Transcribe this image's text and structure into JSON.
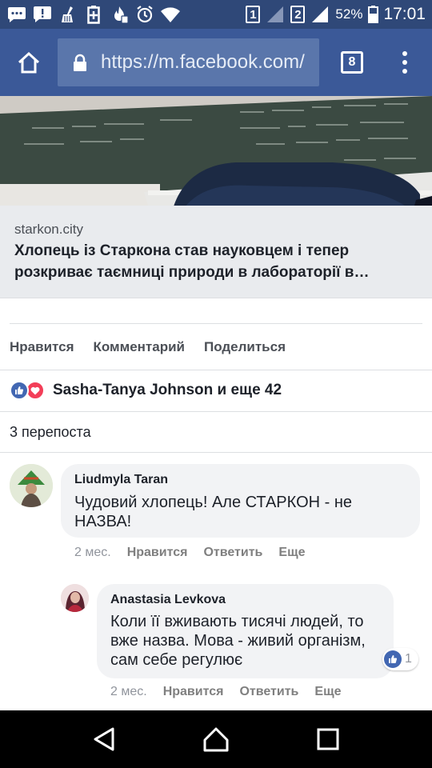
{
  "status_bar": {
    "time": "17:01",
    "battery_percent": "52%",
    "sim1": "1",
    "sim2": "2",
    "icons": [
      "chat-icon",
      "alert-icon",
      "broom-icon",
      "battery-saver-icon",
      "fire-icon",
      "alarm-icon",
      "wifi-icon",
      "signal-icon",
      "battery-icon"
    ]
  },
  "browser": {
    "url": "https://m.facebook.com/",
    "tab_count": "8",
    "icons": [
      "home-icon",
      "lock-icon",
      "more-vert-icon"
    ]
  },
  "link_preview": {
    "domain": "starkon.city",
    "title": "Хлопець із Старкона став науковцем і тепер розкриває таємниці природи в лабораторії в…"
  },
  "actions": {
    "like": "Нравится",
    "comment": "Комментарий",
    "share": "Поделиться"
  },
  "reactions": {
    "summary": "Sasha-Tanya Johnson и еще 42",
    "types": [
      "like-reaction-icon",
      "love-reaction-icon"
    ]
  },
  "shares_count": "3 перепоста",
  "comments": [
    {
      "author": "Liudmyla Taran",
      "text": "Чудовий хлопець! Але СТАРКОН - не НАЗВА!",
      "time": "2 мес.",
      "like": "Нравится",
      "reply": "Ответить",
      "more": "Еще"
    },
    {
      "author": "Anastasia Levkova",
      "text": "Коли її вживають тисячі людей, то вже назва. Мова - живий організм, сам себе регулює",
      "time": "2 мес.",
      "like": "Нравится",
      "reply": "Ответить",
      "more": "Еще",
      "like_count": "1"
    }
  ],
  "nav_bar": {
    "icons": [
      "back-icon",
      "home-nav-icon",
      "recents-icon"
    ]
  },
  "colors": {
    "status_bar": "#2f4878",
    "browser_bar": "#3b5998",
    "url_box": "#5a76ab",
    "like_blue": "#4267b2",
    "love_red": "#f33e58"
  }
}
